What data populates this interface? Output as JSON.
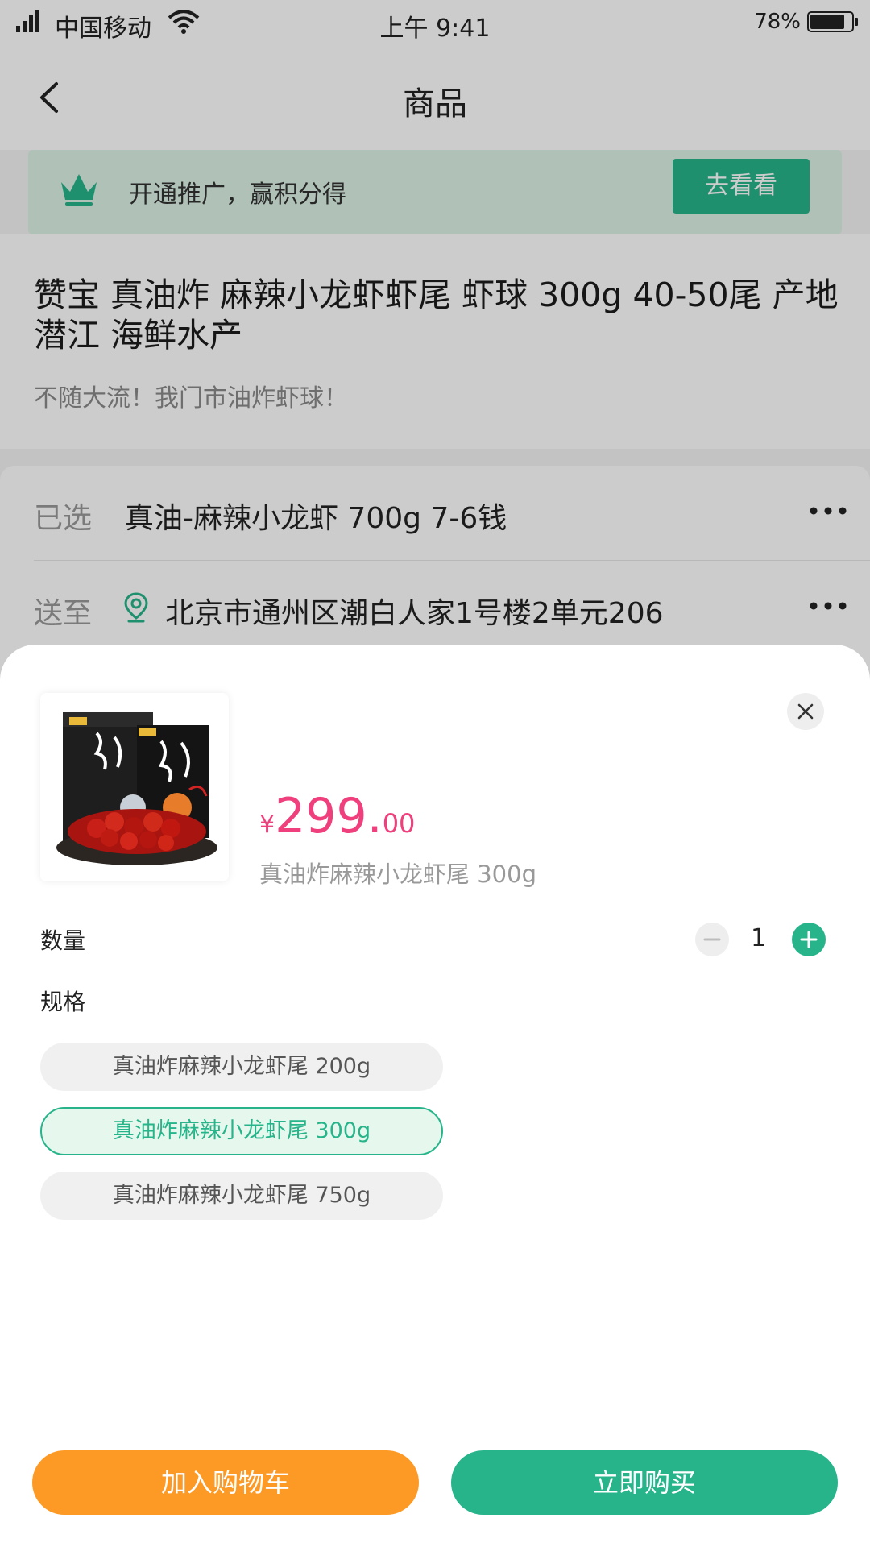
{
  "status_bar": {
    "carrier": "中国移动",
    "time": "上午 9:41",
    "battery": "78%"
  },
  "nav": {
    "title": "商品"
  },
  "promo": {
    "text": "开通推广，赢积分得",
    "button": "去看看"
  },
  "product": {
    "title": "赞宝 真油炸 麻辣小龙虾虾尾 虾球 300g 40-50尾 产地潜江 海鲜水产",
    "subtitle": "不随大流！我门市油炸虾球！"
  },
  "selection": {
    "selected_label": "已选",
    "selected_value": "真油-麻辣小龙虾 700g 7-6钱",
    "ship_label": "送至",
    "ship_value": "北京市通州区潮白人家1号楼2单元206"
  },
  "sheet": {
    "price_symbol": "¥",
    "price_int": "299.",
    "price_dec": "00",
    "spec": "真油炸麻辣小龙虾尾  300g",
    "qty_label": "数量",
    "qty_value": "1",
    "spec_label": "规格",
    "options": [
      {
        "label": "真油炸麻辣小龙虾尾  200g"
      },
      {
        "label": "真油炸麻辣小龙虾尾  300g"
      },
      {
        "label": "真油炸麻辣小龙虾尾  750g"
      }
    ],
    "add_cart": "加入购物车",
    "buy_now": "立即购买"
  },
  "colors": {
    "accent": "#27b48a",
    "price": "#ef3f7c",
    "cart": "#fd9a26"
  }
}
